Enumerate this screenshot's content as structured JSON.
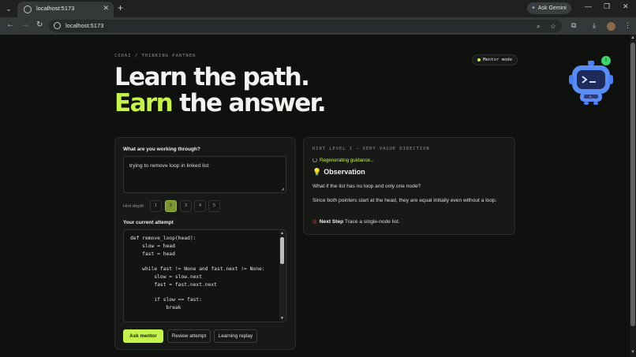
{
  "browser": {
    "tab_title": "localhost:5173",
    "tab_close": "✕",
    "new_tab": "+",
    "url": "localhost:5173",
    "gemini_label": "Ask Gemini",
    "window_controls": [
      "—",
      "❐",
      "✕"
    ],
    "icons": [
      "tab-menu-icon",
      "favicon-icon",
      "back-icon",
      "forward-icon",
      "reload-icon",
      "site-info-icon",
      "zoom-icon",
      "bookmark-star-icon",
      "extensions-icon",
      "download-icon",
      "profile-avatar",
      "more-menu-icon"
    ]
  },
  "header": {
    "eyebrow": "CODAI / THINKING PARTNER",
    "mentor_mode": "Mentor mode",
    "hero_line1": "Learn the path.",
    "hero_line2_accent": "Earn",
    "hero_line2_rest": " the answer.",
    "robot_badge": "!"
  },
  "colors": {
    "accent": "#c6f24e",
    "background": "#0f110f",
    "panel": "#161916",
    "badge_green": "#3fd46b"
  },
  "form": {
    "question_label": "What are you working through?",
    "problem_text": "trying to remove  loop in linked list",
    "hint_depth_label": "Hint depth",
    "depth_options": [
      "1",
      "2",
      "3",
      "4",
      "5"
    ],
    "selected_depth": "2",
    "attempt_label": "Your current attempt",
    "code": "def remove_loop(head):\n    slow = head\n    fast = head\n\n    while fast != None and fast.next != None:\n        slow = slow.next\n        fast = fast.next.next\n\n        if slow == fast:\n            break",
    "ask_mentor": "Ask mentor",
    "review_attempt": "Review attempt",
    "learning_replay": "Learning replay"
  },
  "hint": {
    "eyebrow": "HINT LEVEL 1 — VERY VAGUE DIRECTION",
    "regenerating": "Regenerating guidance...",
    "observation_title": "Observation",
    "question": "What if the list has no loop and only one node?",
    "body": "Since both pointers start at the head, they are equal initially even without a loop.",
    "next_step_label": "Next Step",
    "next_step_text": " Trace a single-node list."
  }
}
